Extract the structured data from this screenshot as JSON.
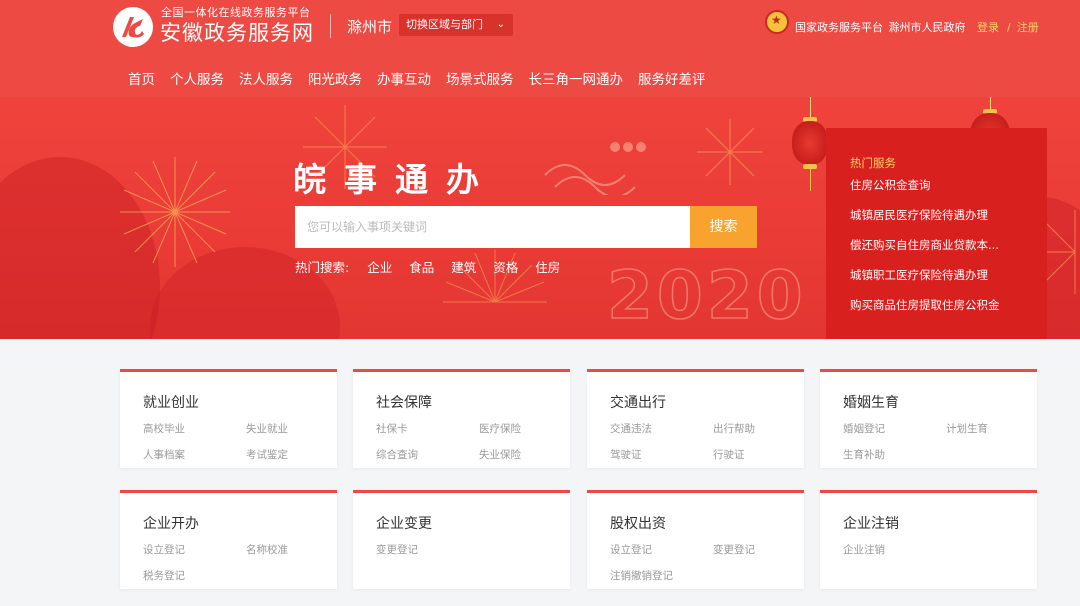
{
  "header": {
    "platform_sub": "全国一体化在线政务服务平台",
    "site_title": "安徽政务服务网",
    "city": "滁州市",
    "switch_label": "切换区域与部门",
    "national_platform": "国家政务服务平台",
    "city_gov": "滁州市人民政府",
    "login": "登录",
    "separator": "/",
    "register": "注册",
    "accent_color": "#ee4a44"
  },
  "nav": {
    "items": [
      "首页",
      "个人服务",
      "法人服务",
      "阳光政务",
      "办事互动",
      "场景式服务",
      "长三角一网通办",
      "服务好差评"
    ]
  },
  "banner": {
    "slogan": "皖事通办",
    "search_placeholder": "您可以输入事项关键词",
    "search_button": "搜索",
    "hot_search_label": "热门搜索:",
    "hot_search_items": [
      "企业",
      "食品",
      "建筑",
      "资格",
      "住房"
    ],
    "decoration_year": "2020"
  },
  "hot_services": {
    "title": "热门服务",
    "items": [
      "住房公积金查询",
      "城镇居民医疗保险待遇办理",
      "偿还购买自住房商业贷款本...",
      "城镇职工医疗保险待遇办理",
      "购买商品住房提取住房公积金"
    ]
  },
  "categories": [
    {
      "title": "就业创业",
      "links": [
        "高校毕业",
        "失业就业",
        "人事档案",
        "考试鉴定"
      ]
    },
    {
      "title": "社会保障",
      "links": [
        "社保卡",
        "医疗保险",
        "综合查询",
        "失业保险"
      ]
    },
    {
      "title": "交通出行",
      "links": [
        "交通违法",
        "出行帮助",
        "驾驶证",
        "行驶证"
      ]
    },
    {
      "title": "婚姻生育",
      "links": [
        "婚姻登记",
        "计划生育",
        "生育补助"
      ]
    },
    {
      "title": "企业开办",
      "links": [
        "设立登记",
        "名称校准",
        "税务登记"
      ]
    },
    {
      "title": "企业变更",
      "links": [
        "变更登记"
      ]
    },
    {
      "title": "股权出资",
      "links": [
        "设立登记",
        "变更登记",
        "注销撤销登记"
      ]
    },
    {
      "title": "企业注销",
      "links": [
        "企业注销"
      ]
    }
  ]
}
